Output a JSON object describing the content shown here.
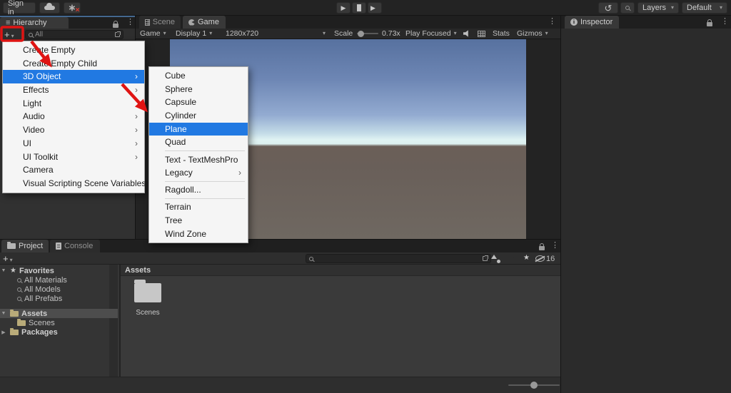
{
  "icons": {
    "plus": "+",
    "caret_down": "▾",
    "chevron_right": "›",
    "kebab": "⋮",
    "star": "★",
    "hierarchy": "≡",
    "play": "▶",
    "history": "↺",
    "close_x": "×",
    "asterisk": "∗",
    "tree_open": "▼",
    "tree_closed": "▶",
    "info": "i"
  },
  "colors": {
    "menu_highlight": "#2179e2",
    "annotation": "#df1413",
    "focus_line": "#44688f"
  },
  "toolbar": {
    "sign_in": "Sign in",
    "layers_dropdown": "Layers",
    "layout_dropdown": "Default"
  },
  "hierarchy": {
    "tab": "Hierarchy",
    "search_placeholder": "All"
  },
  "scene_game": {
    "scene_tab": "Scene",
    "game_tab": "Game",
    "game_popup": "Game",
    "display": "Display 1",
    "resolution": "1280x720",
    "scale_label": "Scale",
    "scale_value": "0.73x",
    "play_focused": "Play Focused",
    "stats": "Stats",
    "gizmos": "Gizmos"
  },
  "inspector": {
    "tab": "Inspector"
  },
  "project": {
    "tab": "Project",
    "console_tab": "Console",
    "hidden_count": "16",
    "assets_header": "Assets",
    "tree": {
      "favorites": "Favorites",
      "all_materials": "All Materials",
      "all_models": "All Models",
      "all_prefabs": "All Prefabs",
      "assets": "Assets",
      "scenes": "Scenes",
      "packages": "Packages"
    },
    "asset_items": [
      {
        "label": "Scenes"
      }
    ]
  },
  "context_menu": {
    "items": [
      {
        "label": "Create Empty"
      },
      {
        "label": "Create Empty Child"
      },
      {
        "label": "3D Object",
        "selected": true,
        "has_submenu": true
      },
      {
        "label": "Effects",
        "has_submenu": true
      },
      {
        "label": "Light"
      },
      {
        "label": "Audio",
        "has_submenu": true
      },
      {
        "label": "Video",
        "has_submenu": true
      },
      {
        "label": "UI",
        "has_submenu": true
      },
      {
        "label": "UI Toolkit",
        "has_submenu": true
      },
      {
        "label": "Camera"
      },
      {
        "label": "Visual Scripting Scene Variables"
      }
    ]
  },
  "submenu": {
    "items": [
      {
        "label": "Cube"
      },
      {
        "label": "Sphere"
      },
      {
        "label": "Capsule"
      },
      {
        "label": "Cylinder"
      },
      {
        "label": "Plane",
        "selected": true
      },
      {
        "label": "Quad"
      },
      {
        "label": "Text - TextMeshPro"
      },
      {
        "label": "Legacy",
        "has_submenu": true
      },
      {
        "label": "Ragdoll..."
      },
      {
        "label": "Terrain"
      },
      {
        "label": "Tree"
      },
      {
        "label": "Wind Zone"
      }
    ]
  }
}
